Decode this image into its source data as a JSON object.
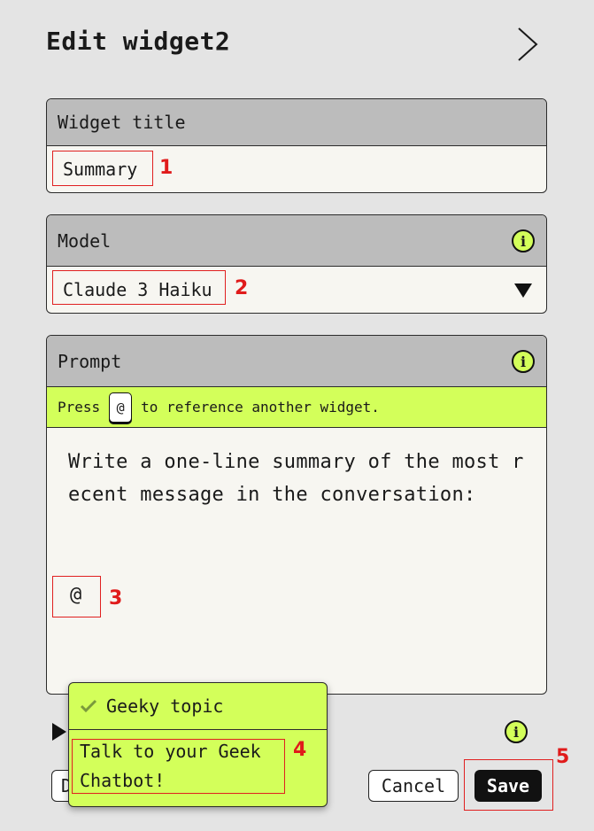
{
  "header": {
    "title": "Edit widget2",
    "forward_icon": "chevron-right-icon"
  },
  "widget_title": {
    "label": "Widget title",
    "value": "Summary",
    "marker": "1"
  },
  "model": {
    "label": "Model",
    "value": "Claude 3 Haiku",
    "marker": "2",
    "info_icon": "info-icon",
    "dropdown_icon": "triangle-down-icon"
  },
  "prompt": {
    "label": "Prompt",
    "info_icon": "info-icon",
    "hint_before": "Press",
    "hint_key": "@",
    "hint_after": "to reference another widget.",
    "text": "Write a one-line summary of the most recent message in the conversation:",
    "mention": "@",
    "marker": "3"
  },
  "mention_popup": {
    "group_label": "Geeky topic",
    "group_icon": "checkmark-icon",
    "item": "Talk to your Geek Chatbot!",
    "marker": "4"
  },
  "footer": {
    "cancel_label": "Cancel",
    "save_label": "Save",
    "save_marker": "5",
    "partial_button_label": "D"
  },
  "colors": {
    "accent": "#d3ff5a",
    "header_bg": "#bcbcbc",
    "field_bg": "#f7f6f1",
    "page_bg": "#e4e4e4",
    "marker": "#e01b1b"
  }
}
